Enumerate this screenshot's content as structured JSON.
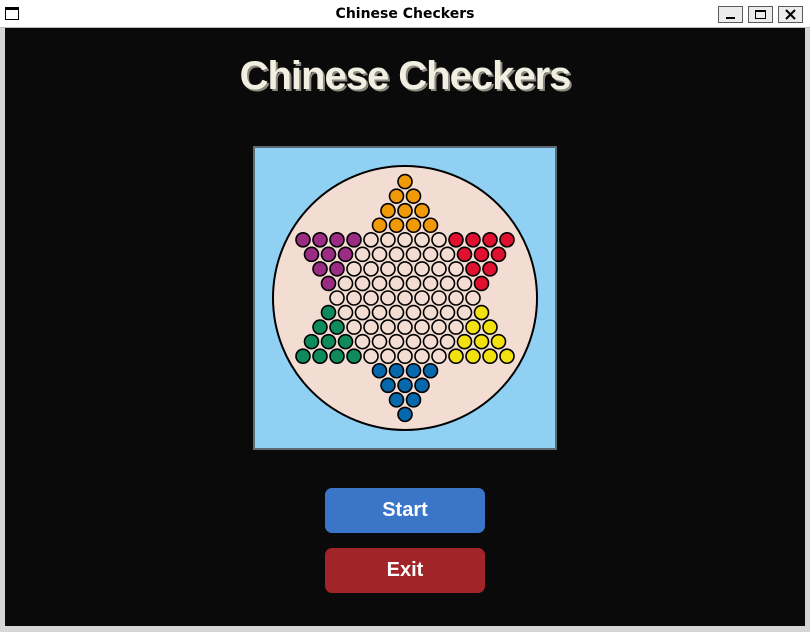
{
  "window": {
    "title": "Chinese Checkers",
    "icons": [
      "app-window-icon",
      "minimize-icon",
      "maximize-icon",
      "close-icon"
    ]
  },
  "game": {
    "title": "Chinese Checkers",
    "board": {
      "background": "#8fd0f3",
      "disc_color": "#f3ddd3",
      "empty_hole_color": "#f3ddd3",
      "players": [
        {
          "corner": "top",
          "color": "#f09a08"
        },
        {
          "corner": "top-left",
          "color": "#9b2c83"
        },
        {
          "corner": "top-right",
          "color": "#e0102f"
        },
        {
          "corner": "bottom-left",
          "color": "#0e8a5c"
        },
        {
          "corner": "bottom-right",
          "color": "#f3e10f"
        },
        {
          "corner": "bottom",
          "color": "#0768ab"
        }
      ]
    }
  },
  "buttons": {
    "start": {
      "label": "Start",
      "color": "#3a75c7"
    },
    "exit": {
      "label": "Exit",
      "color": "#a02428"
    }
  }
}
